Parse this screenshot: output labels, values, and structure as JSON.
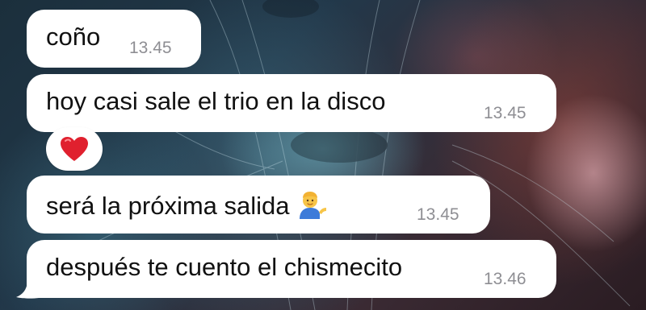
{
  "messages": [
    {
      "text": "coño",
      "time": "13.45"
    },
    {
      "text": "hoy casi sale el trio en la disco",
      "time": "13.45"
    },
    {
      "text": "será la próxima salida",
      "emoji": "person-tipping-hand-emoji",
      "time": "13.45"
    },
    {
      "text": "después te cuento el chismecito",
      "time": "13.46"
    }
  ],
  "reaction": {
    "emoji": "heart-emoji",
    "color": "#e0202e"
  },
  "colors": {
    "bubble": "#ffffff",
    "text": "#111111",
    "timestamp": "#8e8e93"
  }
}
